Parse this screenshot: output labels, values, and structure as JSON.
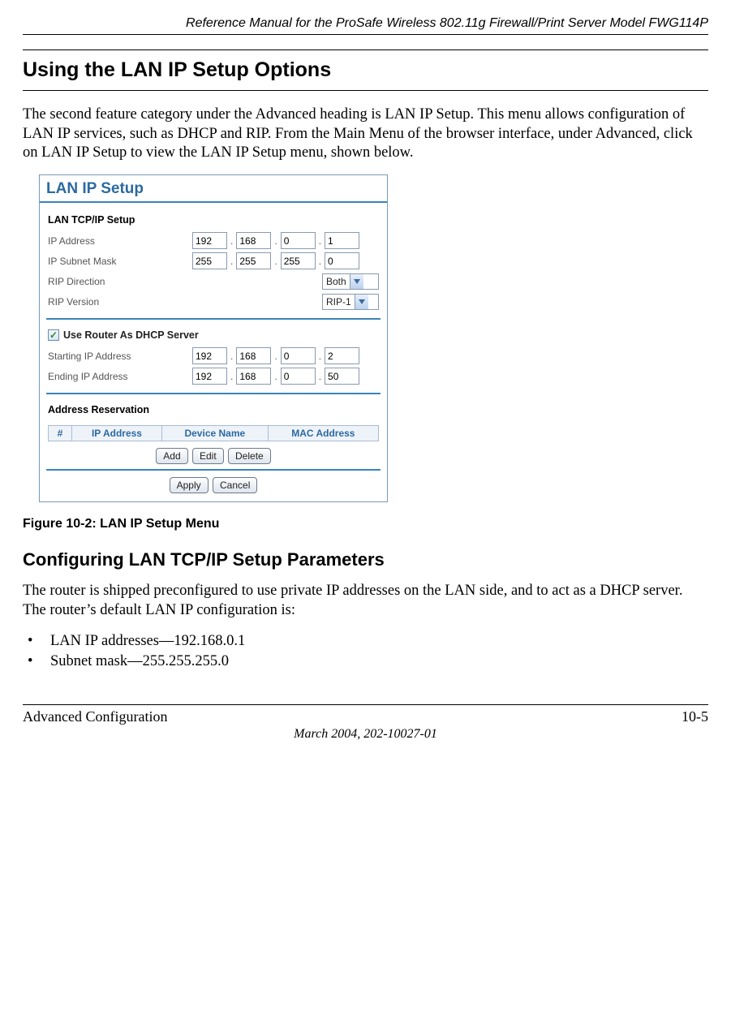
{
  "header": {
    "running": "Reference Manual for the ProSafe Wireless 802.11g  Firewall/Print Server Model FWG114P"
  },
  "section": {
    "title": "Using the LAN IP Setup Options",
    "intro": "The second feature category under the Advanced heading is LAN IP Setup. This menu allows configuration of LAN IP services, such as DHCP and RIP. From the Main Menu of the browser interface, under Advanced, click on LAN IP Setup to view the LAN IP Setup menu, shown below."
  },
  "panel": {
    "title": "LAN IP Setup",
    "tcpip": {
      "heading": "LAN TCP/IP Setup",
      "ip_label": "IP Address",
      "ip": [
        "192",
        "168",
        "0",
        "1"
      ],
      "mask_label": "IP Subnet Mask",
      "mask": [
        "255",
        "255",
        "255",
        "0"
      ],
      "rip_dir_label": "RIP Direction",
      "rip_dir_value": "Both",
      "rip_ver_label": "RIP Version",
      "rip_ver_value": "RIP-1"
    },
    "dhcp": {
      "checkbox_label": "Use Router As DHCP Server",
      "checked": true,
      "start_label": "Starting IP Address",
      "start": [
        "192",
        "168",
        "0",
        "2"
      ],
      "end_label": "Ending IP Address",
      "end": [
        "192",
        "168",
        "0",
        "50"
      ]
    },
    "reservation": {
      "heading": "Address Reservation",
      "cols": {
        "num": "#",
        "ip": "IP Address",
        "dev": "Device Name",
        "mac": "MAC Address"
      },
      "buttons": {
        "add": "Add",
        "edit": "Edit",
        "del": "Delete"
      }
    },
    "footer_buttons": {
      "apply": "Apply",
      "cancel": "Cancel"
    }
  },
  "figure_caption": "Figure 10-2:  LAN IP Setup Menu",
  "subsection": {
    "title": "Configuring LAN TCP/IP Setup Parameters",
    "body": "The router is shipped preconfigured to use private IP addresses on the LAN side, and to act as a DHCP server. The router’s default LAN IP configuration is:",
    "bullets": [
      "LAN IP addresses—192.168.0.1",
      "Subnet mask—255.255.255.0"
    ]
  },
  "footer": {
    "left": "Advanced Configuration",
    "right": "10-5",
    "center": "March 2004, 202-10027-01"
  }
}
